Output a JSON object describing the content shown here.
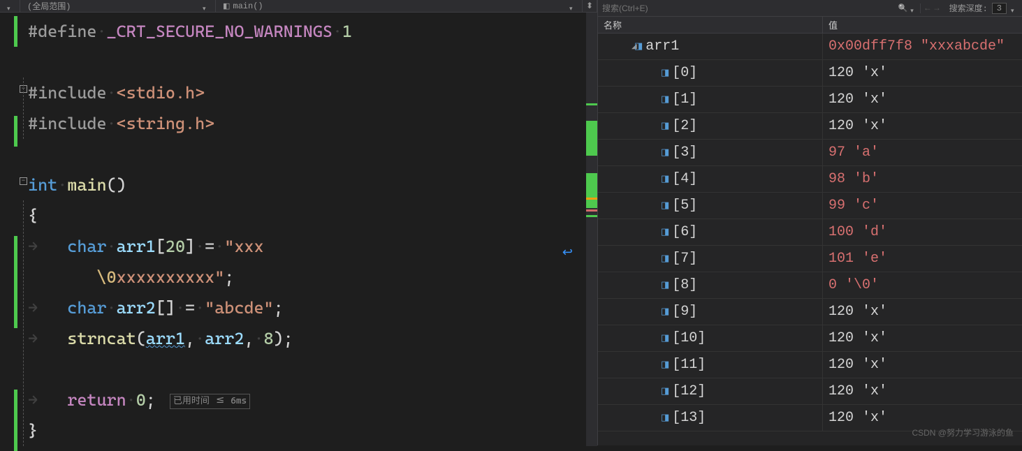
{
  "toolbar": {
    "scope": "(全局范围)",
    "func": "main()"
  },
  "code": {
    "l1_def": "#define",
    "l1_name": "_CRT_SECURE_NO_WARNINGS",
    "l1_val": "1",
    "l3_inc": "#include",
    "l3_h": "<stdio.h>",
    "l4_inc": "#include",
    "l4_h": "<string.h>",
    "l6_int": "int",
    "l6_main": "main",
    "l7_brace": "{",
    "l8_char": "char",
    "l8_arr1": "arr1",
    "l8_idx": "20",
    "l8_eq": "=",
    "l8_s1": "\"xxx",
    "l9_s2": "\\0",
    "l9_s3": "xxxxxxxxxx\"",
    "l10_char": "char",
    "l10_arr2": "arr2",
    "l10_eq": "=",
    "l10_s": "\"abcde\"",
    "l11_fn": "strncat",
    "l11_a1": "arr1",
    "l11_a2": "arr2",
    "l11_n": "8",
    "l13_ret": "return",
    "l13_v": "0",
    "l13_time": "已用时间 <= 6ms",
    "l14_brace": "}"
  },
  "watch": {
    "search_placeholder": "搜索(Ctrl+E)",
    "depth_label": "搜索深度:",
    "depth_value": "3",
    "col_name": "名称",
    "col_value": "值",
    "rows": [
      {
        "name": "arr1",
        "value": "0x00dff7f8 \"xxxabcde\"",
        "changed": true,
        "root": true
      },
      {
        "name": "[0]",
        "value": "120 'x'",
        "changed": false
      },
      {
        "name": "[1]",
        "value": "120 'x'",
        "changed": false
      },
      {
        "name": "[2]",
        "value": "120 'x'",
        "changed": false
      },
      {
        "name": "[3]",
        "value": "97 'a'",
        "changed": true
      },
      {
        "name": "[4]",
        "value": "98 'b'",
        "changed": true
      },
      {
        "name": "[5]",
        "value": "99 'c'",
        "changed": true
      },
      {
        "name": "[6]",
        "value": "100 'd'",
        "changed": true
      },
      {
        "name": "[7]",
        "value": "101 'e'",
        "changed": true
      },
      {
        "name": "[8]",
        "value": "0 '\\0'",
        "changed": true
      },
      {
        "name": "[9]",
        "value": "120 'x'",
        "changed": false
      },
      {
        "name": "[10]",
        "value": "120 'x'",
        "changed": false
      },
      {
        "name": "[11]",
        "value": "120 'x'",
        "changed": false
      },
      {
        "name": "[12]",
        "value": "120 'x'",
        "changed": false
      },
      {
        "name": "[13]",
        "value": "120 'x'",
        "changed": false
      }
    ]
  },
  "watermark": "CSDN @努力学习游泳的鱼"
}
